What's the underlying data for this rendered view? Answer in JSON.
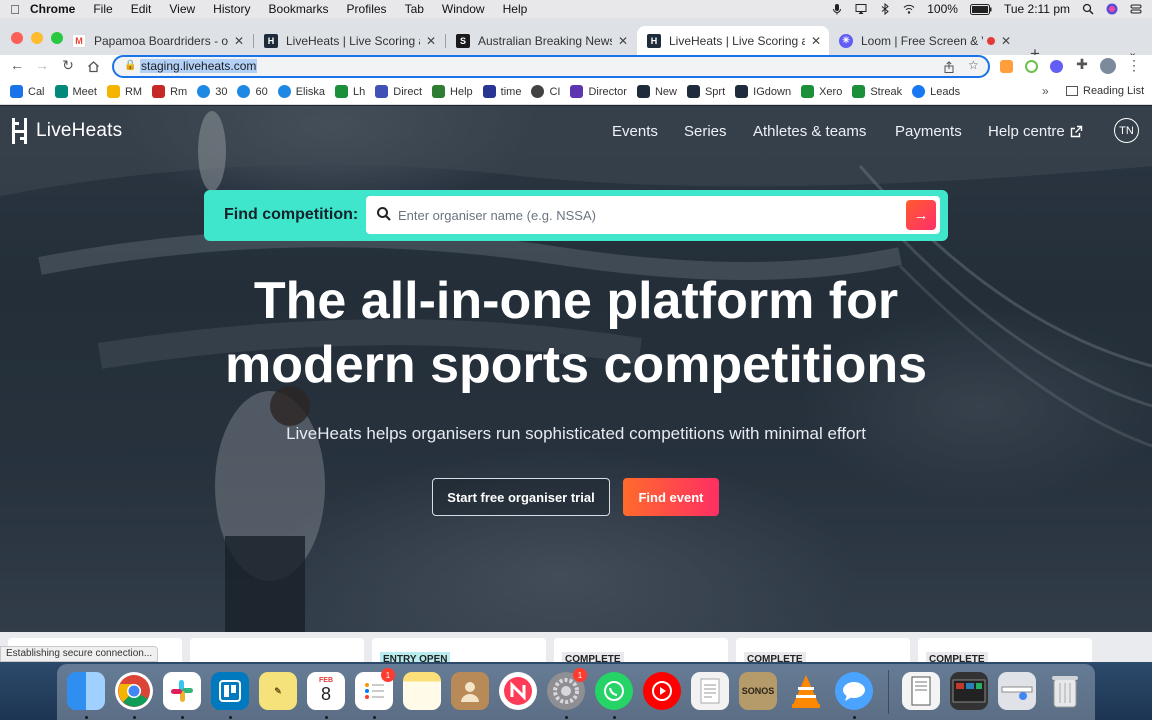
{
  "menubar": {
    "app": "Chrome",
    "items": [
      "File",
      "Edit",
      "View",
      "History",
      "Bookmarks",
      "Profiles",
      "Tab",
      "Window",
      "Help"
    ],
    "battery": "100%",
    "clock": "Tue 2:11 pm"
  },
  "tabs": [
    {
      "title": "Papamoa Boardriders - order c",
      "favicon": "gmail-icon",
      "active": false
    },
    {
      "title": "LiveHeats | Live Scoring and C",
      "favicon": "liveheats-icon",
      "active": false
    },
    {
      "title": "Australian Breaking News Head",
      "favicon": "news-icon",
      "active": false
    },
    {
      "title": "LiveHeats | Live Scoring and C",
      "favicon": "liveheats-icon",
      "active": true
    },
    {
      "title": "Loom | Free Screen & Video",
      "favicon": "loom-icon",
      "active": false
    }
  ],
  "toolbar": {
    "url": "staging.liveheats.com"
  },
  "bookmarks": [
    {
      "label": "Cal",
      "color": "#1a73e8"
    },
    {
      "label": "Meet",
      "color": "#00897b"
    },
    {
      "label": "RM",
      "color": "#f4b400"
    },
    {
      "label": "Rm",
      "color": "#c62828"
    },
    {
      "label": "30",
      "color": "#1e88e5"
    },
    {
      "label": "60",
      "color": "#1e88e5"
    },
    {
      "label": "Eliska",
      "color": "#1e88e5"
    },
    {
      "label": "Lh",
      "color": "#1b8f3a"
    },
    {
      "label": "Direct",
      "color": "#3f51b5"
    },
    {
      "label": "Help",
      "color": "#2e7d32"
    },
    {
      "label": "time",
      "color": "#283593"
    },
    {
      "label": "CI",
      "color": "#424242"
    },
    {
      "label": "Director",
      "color": "#5e35b1"
    },
    {
      "label": "New",
      "color": "#1d2b3a"
    },
    {
      "label": "Sprt",
      "color": "#1d2b3a"
    },
    {
      "label": "IGdown",
      "color": "#1d2b3a"
    },
    {
      "label": "Xero",
      "color": "#1b8f3a"
    },
    {
      "label": "Streak",
      "color": "#1b8f3a"
    },
    {
      "label": "Leads",
      "color": "#1877f2"
    }
  ],
  "reading_list": "Reading List",
  "site": {
    "logo_text": "LiveHeats",
    "nav": [
      "Events",
      "Series",
      "Athletes & teams",
      "Payments",
      "Help centre"
    ],
    "help_external_icon": "external-link-icon",
    "avatar_initials": "TN",
    "find_label": "Find competition:",
    "find_placeholder": "Enter organiser name (e.g. NSSA)",
    "headline_line1": "The all-in-one platform for",
    "headline_line2": "modern sports competitions",
    "subline": "LiveHeats helps organisers run sophisticated competitions with minimal effort",
    "btn_trial": "Start free organiser trial",
    "btn_find": "Find event",
    "colors": {
      "find_bar": "#3fe6cb",
      "accent_start": "#ff6a2b",
      "accent_end": "#ff2f63"
    }
  },
  "cards": {
    "badges": [
      "ENTRY OPEN",
      "COMPLETE",
      "COMPLETE",
      "COMPLETE"
    ]
  },
  "status": "Establishing secure connection...",
  "dock": [
    {
      "name": "Finder",
      "color": "#3b8ee8"
    },
    {
      "name": "Chrome",
      "color": "#e9ecef"
    },
    {
      "name": "Slack",
      "color": "#ffffff"
    },
    {
      "name": "Trello",
      "color": "#0079bf"
    },
    {
      "name": "Stickies",
      "color": "#f6e27a"
    },
    {
      "name": "Calendar",
      "color": "#ffffff",
      "month": "FEB",
      "day": "8"
    },
    {
      "name": "Reminders",
      "color": "#ffffff",
      "badge": "1"
    },
    {
      "name": "Notes",
      "color": "#fbe07a"
    },
    {
      "name": "Contacts",
      "color": "#b88a57"
    },
    {
      "name": "News",
      "color": "#ffffff"
    },
    {
      "name": "System Preferences",
      "color": "#8e8e93",
      "badge": "1"
    },
    {
      "name": "WhatsApp",
      "color": "#25d366"
    },
    {
      "name": "YouTube",
      "color": "#ff0000"
    },
    {
      "name": "TextEdit",
      "color": "#f2f2f2"
    },
    {
      "name": "Sonos",
      "color": "#b59a6a",
      "label": "SONOS"
    },
    {
      "name": "VLC",
      "color": "#ff8800"
    },
    {
      "name": "Messages",
      "color": "#4aa3ff"
    },
    {
      "name": "Document",
      "color": "#f4f4f4"
    },
    {
      "name": "Screenshot",
      "color": "#333333"
    },
    {
      "name": "Downloads",
      "color": "#dfe3e8"
    },
    {
      "name": "Trash",
      "color": "#e6e8ea"
    }
  ]
}
